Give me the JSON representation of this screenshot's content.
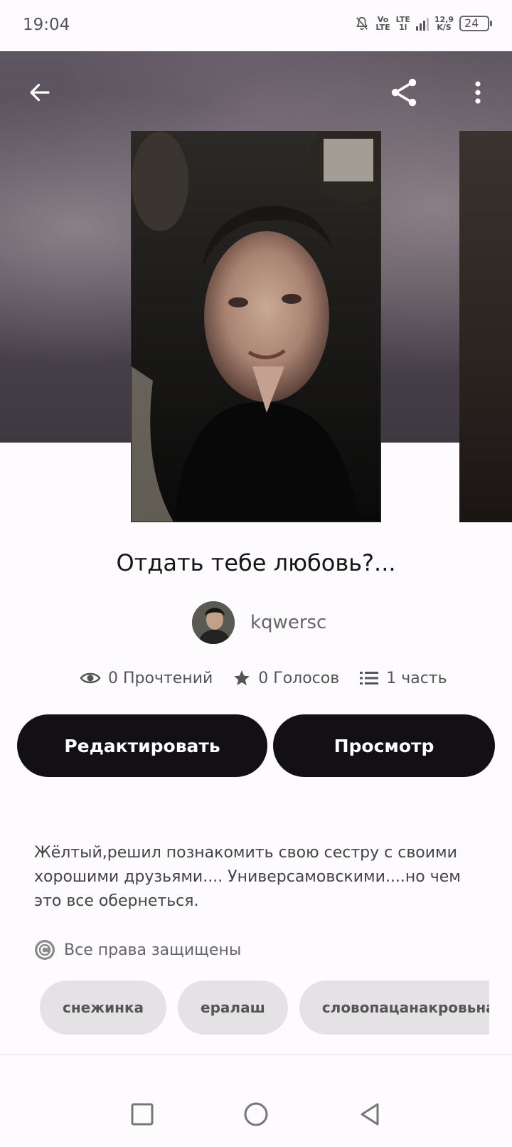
{
  "status_bar": {
    "time": "19:04",
    "volte_top": "Vo",
    "volte_bottom": "LTE",
    "lte_top": "LTE",
    "lte_bottom": "1l",
    "speed_value": "12,9",
    "speed_unit": "K/S",
    "battery": "24"
  },
  "header": {
    "back_icon": "arrow-left-icon",
    "share_icon": "share-icon",
    "more_icon": "more-vertical-icon"
  },
  "story": {
    "title": "Отдать тебе любовь?...",
    "author": "kqwersc",
    "stats": {
      "reads": "0 Прочтений",
      "votes": "0 Голосов",
      "parts": "1 часть"
    },
    "edit_label": "Редактировать",
    "view_label": "Просмотр",
    "description": "Жёлтый,решил познакомить свою сестру с своими хорошими друзьями.... Универсамовскими....но чем это все обернеться.",
    "copyright": "Все права защищены",
    "tags": [
      "снежинка",
      "ералаш",
      "словопацанакровьнаасфальте"
    ]
  },
  "colors": {
    "button_bg": "#121015",
    "tag_bg": "#e4e2e4",
    "page_bg": "#fdfbfd"
  }
}
